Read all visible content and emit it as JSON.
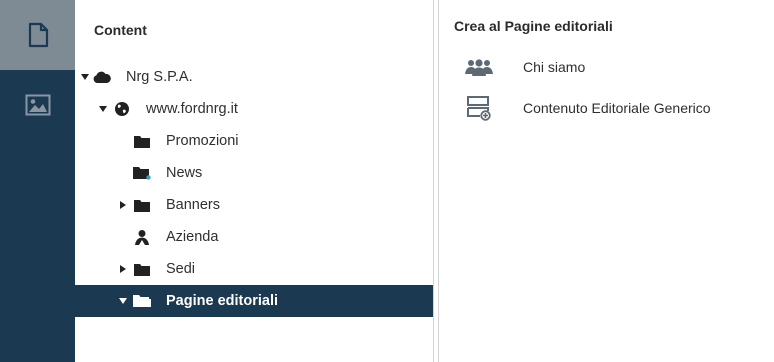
{
  "rail": {
    "items": [
      {
        "name": "content",
        "icon": "document-icon",
        "active": true
      },
      {
        "name": "media",
        "icon": "image-icon",
        "active": false
      }
    ]
  },
  "tree": {
    "title": "Content",
    "nodes": [
      {
        "label": "Nrg S.P.A.",
        "icon": "cloud-icon",
        "expanded": true
      },
      {
        "label": "www.fordnrg.it",
        "icon": "globe-icon",
        "expanded": true
      },
      {
        "label": "Promozioni",
        "icon": "folder-icon"
      },
      {
        "label": "News",
        "icon": "folder-news-icon"
      },
      {
        "label": "Banners",
        "icon": "folder-icon",
        "expandable": true
      },
      {
        "label": "Azienda",
        "icon": "person-icon"
      },
      {
        "label": "Sedi",
        "icon": "folder-icon",
        "expandable": true
      },
      {
        "label": "Pagine editoriali",
        "icon": "folder-icon",
        "expanded": true,
        "selected": true
      }
    ]
  },
  "create": {
    "title": "Crea al Pagine editoriali",
    "items": [
      {
        "label": "Chi siamo",
        "icon": "users-icon"
      },
      {
        "label": "Contenuto Editoriale Generico",
        "icon": "add-block-icon"
      }
    ]
  },
  "colors": {
    "rail_bg": "#1b3950",
    "rail_active": "#7e8b95",
    "selected_bg": "#1b3950"
  }
}
